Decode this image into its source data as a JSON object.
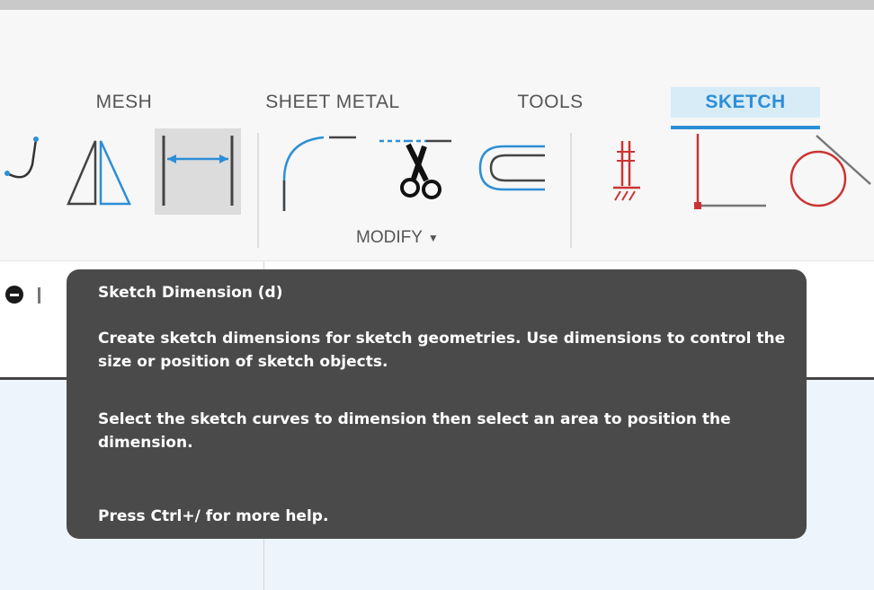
{
  "ribbon": {
    "tabs": [
      {
        "label": "MESH"
      },
      {
        "label": "SHEET METAL"
      },
      {
        "label": "TOOLS"
      },
      {
        "label": "SKETCH",
        "active": true
      }
    ],
    "modify_label": "MODIFY",
    "tools": [
      "spline-icon",
      "mirror-icon",
      "sketch-dimension-icon",
      "fillet-icon",
      "trim-icon",
      "offset-icon",
      "constraint-fix-icon",
      "coincident-constraint-icon",
      "tangent-constraint-icon"
    ]
  },
  "tooltip": {
    "title": "Sketch Dimension (d)",
    "description_1": "Create sketch dimensions for sketch geometries. Use dimensions to control the size or position of sketch objects.",
    "description_2": "Select the sketch curves to dimension then select an area to position the dimension.",
    "help": "Press Ctrl+/ for more help."
  },
  "colors": {
    "accent": "#2d8ed6",
    "constraint_red": "#cc3333",
    "tooltip_bg": "#4a4a4a"
  }
}
